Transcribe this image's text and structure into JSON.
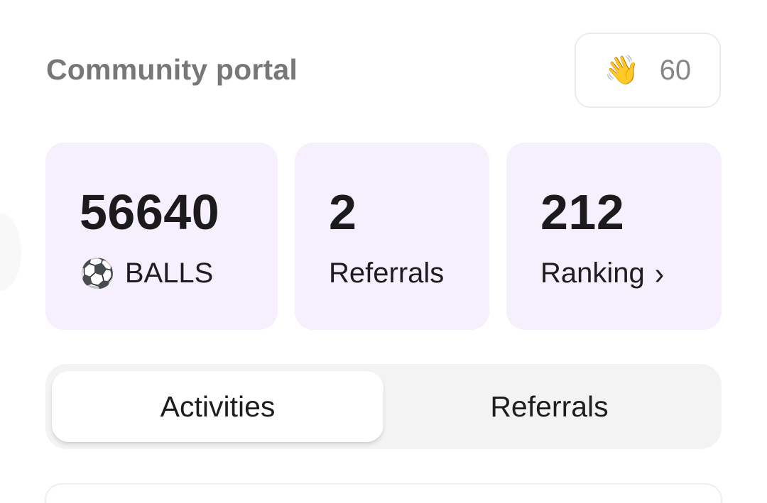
{
  "header": {
    "title": "Community portal",
    "wave": {
      "icon": "waving-hand-icon",
      "emoji": "👋",
      "count": "60"
    }
  },
  "stats": [
    {
      "value": "56640",
      "label": "BALLS",
      "icon": "soccer-ball-icon",
      "icon_glyph": "⚽"
    },
    {
      "value": "2",
      "label": "Referrals"
    },
    {
      "value": "212",
      "label": "Ranking",
      "icon": "chevron-right-icon",
      "icon_glyph": "›"
    }
  ],
  "tabs": [
    {
      "label": "Activities",
      "active": true
    },
    {
      "label": "Referrals",
      "active": false
    }
  ],
  "colors": {
    "card_bg": "#f6effd",
    "tab_bar_bg": "#f3f3f4",
    "title_gray": "#77777a"
  }
}
